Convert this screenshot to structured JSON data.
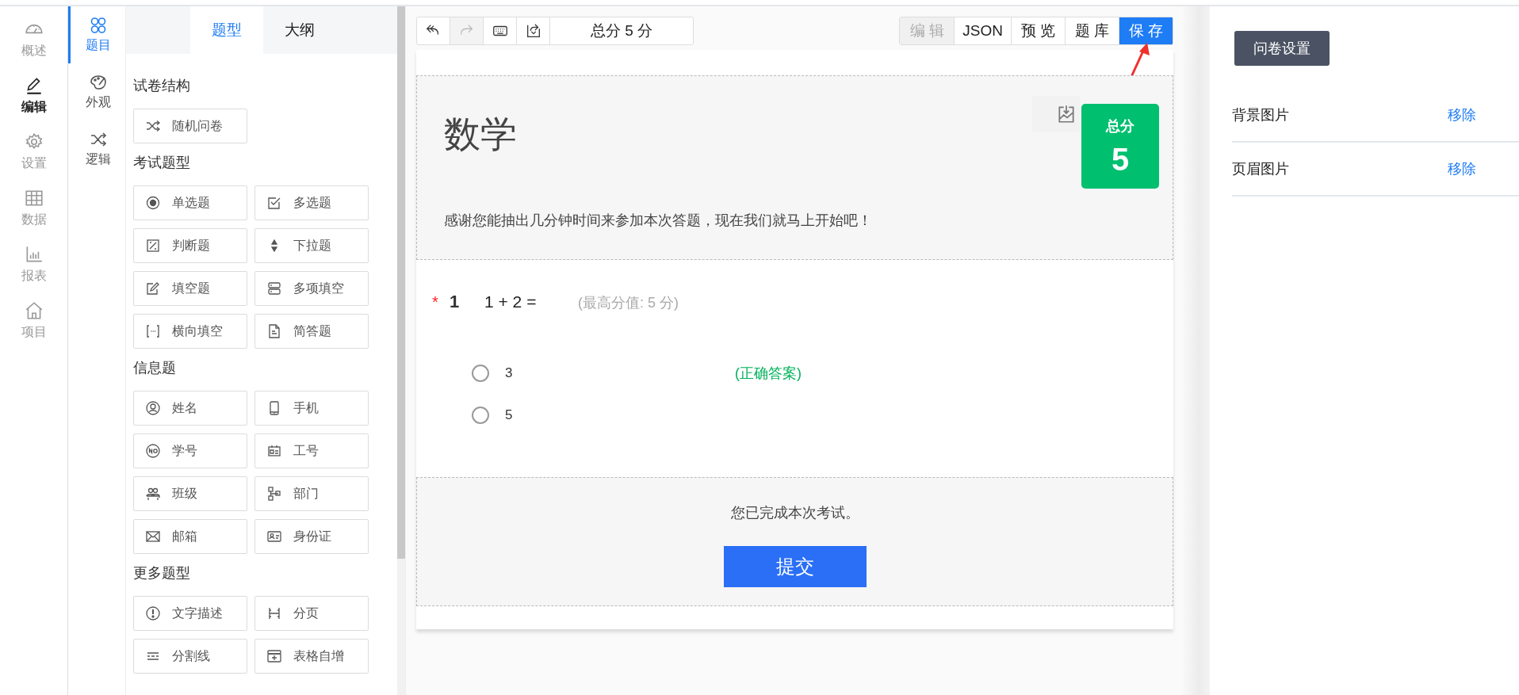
{
  "nav": [
    {
      "label": "概述",
      "selected": false
    },
    {
      "label": "编辑",
      "selected": true
    },
    {
      "label": "设置",
      "selected": false
    },
    {
      "label": "数据",
      "selected": false
    },
    {
      "label": "报表",
      "selected": false
    },
    {
      "label": "项目",
      "selected": false
    }
  ],
  "subnav": [
    {
      "label": "题目",
      "selected": true
    },
    {
      "label": "外观",
      "selected": false
    },
    {
      "label": "逻辑",
      "selected": false
    }
  ],
  "palette": {
    "tabs": [
      {
        "label": "题型",
        "selected": true
      },
      {
        "label": "大纲",
        "selected": false
      }
    ],
    "sections": [
      {
        "title": "试卷结构",
        "items": [
          "随机问卷"
        ]
      },
      {
        "title": "考试题型",
        "items": [
          "单选题",
          "多选题",
          "判断题",
          "下拉题",
          "填空题",
          "多项填空",
          "横向填空",
          "简答题"
        ]
      },
      {
        "title": "信息题",
        "items": [
          "姓名",
          "手机",
          "学号",
          "工号",
          "班级",
          "部门",
          "邮箱",
          "身份证"
        ]
      },
      {
        "title": "更多题型",
        "items": [
          "文字描述",
          "分页",
          "分割线",
          "表格自增"
        ]
      }
    ]
  },
  "toolbar": {
    "tools": [
      {
        "disabled": false
      },
      {
        "disabled": true
      },
      {
        "disabled": false
      },
      {
        "disabled": false
      }
    ],
    "score": "总分 5 分",
    "actions": [
      {
        "label": "编 辑",
        "kind": "disabled"
      },
      {
        "label": "JSON",
        "kind": "default"
      },
      {
        "label": "预 览",
        "kind": "default"
      },
      {
        "label": "题 库",
        "kind": "default"
      },
      {
        "label": "保 存",
        "kind": "primary"
      }
    ]
  },
  "header": {
    "title": "数学",
    "description": "感谢您能抽出几分钟时间来参加本次答题，现在我们就马上开始吧！",
    "score": {
      "label": "总分",
      "value": "5"
    }
  },
  "question": {
    "required": true,
    "required_mark": "*",
    "number": "1",
    "text": "1 + 2 =",
    "max_score": "(最高分值: 5 分)",
    "options": [
      {
        "label": "3",
        "selected": false,
        "note": "(正确答案)"
      },
      {
        "label": "5",
        "selected": false
      }
    ]
  },
  "footer": {
    "message": "您已完成本次考试。",
    "submit": "提交"
  },
  "settings": {
    "button": "问卷设置",
    "rows": [
      {
        "label": "背景图片",
        "action": "移除"
      },
      {
        "label": "页眉图片",
        "action": "移除"
      }
    ]
  }
}
